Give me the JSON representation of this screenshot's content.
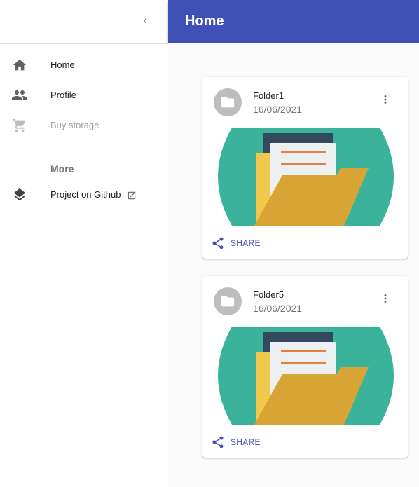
{
  "drawer": {
    "collapse_icon": "chevron-left-icon",
    "items": [
      {
        "label": "Home",
        "icon": "home-icon"
      },
      {
        "label": "Profile",
        "icon": "people-icon"
      },
      {
        "label": "Buy storage",
        "icon": "cart-icon",
        "disabled": true
      }
    ],
    "more_label": "More",
    "github_label": "Project on Github",
    "github_icon": "layers-icon"
  },
  "appbar": {
    "title": "Home",
    "color": "#3f51b5"
  },
  "cards": [
    {
      "title": "Folder1",
      "date": "16/06/2021",
      "share_label": "SHARE"
    },
    {
      "title": "Folder5",
      "date": "16/06/2021",
      "share_label": "SHARE"
    }
  ],
  "colors": {
    "accent": "#3f51b5",
    "media_teal": "#3ab39a",
    "folder_gold": "#d8a436"
  }
}
